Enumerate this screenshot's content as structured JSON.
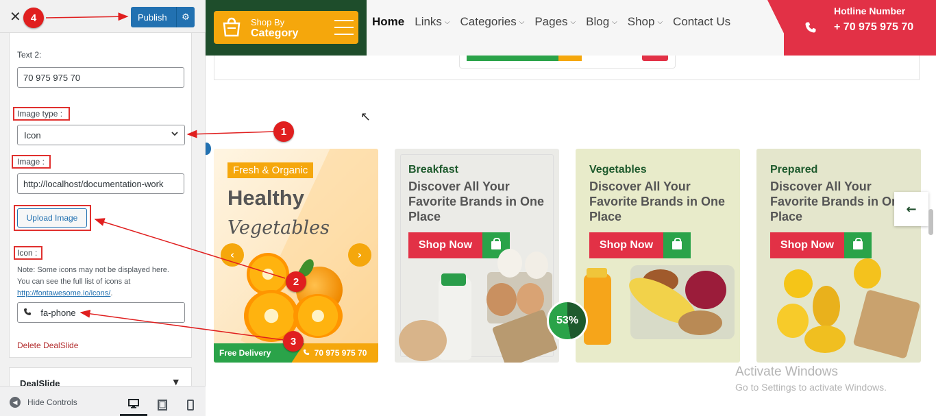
{
  "customizer": {
    "publish_label": "Publish",
    "text2_label": "Text 2:",
    "text2_value": "70 975 975 70",
    "image_type_label": "Image type :",
    "image_type_value": "Icon",
    "image_label": "Image :",
    "image_value": "http://localhost/documentation-work",
    "upload_label": "Upload Image",
    "icon_label": "Icon :",
    "note_line1": "Note: Some icons may not be displayed here.",
    "note_line2": "You can see the full list of icons at",
    "note_link": "http://fontawesome.io/icons/",
    "note_end": ".",
    "icon_value": "fa-phone",
    "delete_label": "Delete DealSlide",
    "next_section": "DealSlide",
    "hide_controls": "Hide Controls"
  },
  "annotations": [
    "1",
    "2",
    "3",
    "4"
  ],
  "header": {
    "shop_by_line1": "Shop By",
    "shop_by_line2": "Category",
    "nav": [
      "Home",
      "Links",
      "Categories",
      "Pages",
      "Blog",
      "Shop",
      "Contact Us"
    ],
    "hotline_title": "Hotline Number",
    "hotline_number": "+ 70 975 975 70"
  },
  "hero": {
    "tag": "Fresh & Organic",
    "title": "Healthy",
    "script": "Vegetables",
    "free_delivery": "Free Delivery",
    "phone": "70 975 975 70"
  },
  "cards": [
    {
      "category": "Breakfast",
      "headline": "Discover All Your Favorite Brands in One Place",
      "button": "Shop Now"
    },
    {
      "category": "Vegetables",
      "headline": "Discover All Your Favorite Brands in One Place",
      "button": "Shop Now"
    },
    {
      "category": "Prepared",
      "headline": "Discover All Your Favorite Brands in One Place",
      "button": "Shop Now"
    }
  ],
  "progress_percent": "53%",
  "watermark": {
    "line1": "Activate Windows",
    "line2": "Go to Settings to activate Windows."
  },
  "colors": {
    "accent_green": "#2aa349",
    "dark_green": "#1e4d2b",
    "orange": "#f5a70c",
    "red": "#e23146",
    "wp_blue": "#2271b1"
  }
}
